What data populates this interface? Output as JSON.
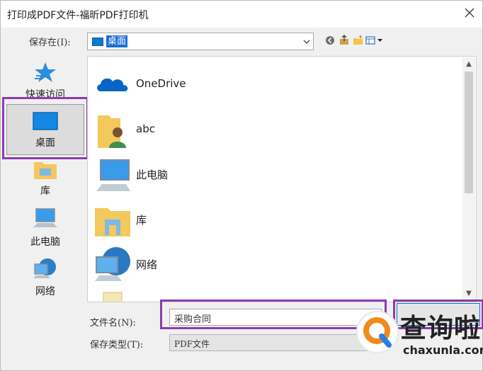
{
  "window": {
    "title": "打印成PDF文件-福昕PDF打印机"
  },
  "toolbar": {
    "save_in_label": "保存在(I):",
    "location_value": "桌面"
  },
  "places": [
    {
      "label": "快速访问",
      "icon": "star-icon"
    },
    {
      "label": "桌面",
      "icon": "desktop-icon",
      "selected": true
    },
    {
      "label": "库",
      "icon": "library-icon"
    },
    {
      "label": "此电脑",
      "icon": "computer-icon"
    },
    {
      "label": "网络",
      "icon": "network-icon"
    }
  ],
  "files": [
    {
      "label": "OneDrive",
      "icon": "onedrive-cloud-icon"
    },
    {
      "label": "abc",
      "icon": "user-folder-icon"
    },
    {
      "label": "此电脑",
      "icon": "computer-icon"
    },
    {
      "label": "库",
      "icon": "library-folder-icon"
    },
    {
      "label": "网络",
      "icon": "network-globe-icon"
    }
  ],
  "form": {
    "filename_label": "文件名(N):",
    "filename_value": "采购合同",
    "filetype_label": "保存类型(T):",
    "filetype_value": "PDF文件"
  },
  "watermark": {
    "cn": "查询啦",
    "en": "chaxunla.com"
  },
  "colors": {
    "highlight": "#8e3cae",
    "selection": "#1a6fd1",
    "accent": "#0a73cf"
  }
}
